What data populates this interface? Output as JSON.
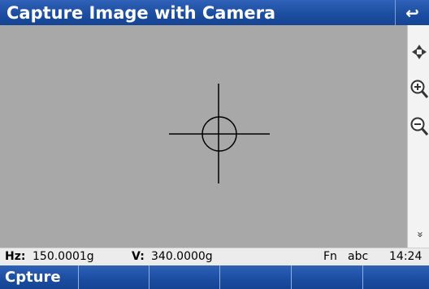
{
  "window": {
    "title": "Capture Image with Camera",
    "back_icon": "return-arrow-icon",
    "back_glyph": "↩"
  },
  "sidebar": {
    "icons": [
      "move-arrows-icon",
      "zoom-in-icon",
      "zoom-out-icon",
      "expand-down-icon"
    ],
    "expand_glyph": "»"
  },
  "status": {
    "hz_label": "Hz:",
    "hz_value": "150.0001g",
    "v_label": "V:",
    "v_value": "340.0000g",
    "fn": "Fn",
    "input_mode": "abc",
    "time": "14:24"
  },
  "softkeys": [
    "Cpture",
    "",
    "",
    "",
    "",
    ""
  ],
  "colors": {
    "title_bar": "#1a4c9f",
    "viewport": "#a8a8a8",
    "status_bar": "#ececec"
  }
}
